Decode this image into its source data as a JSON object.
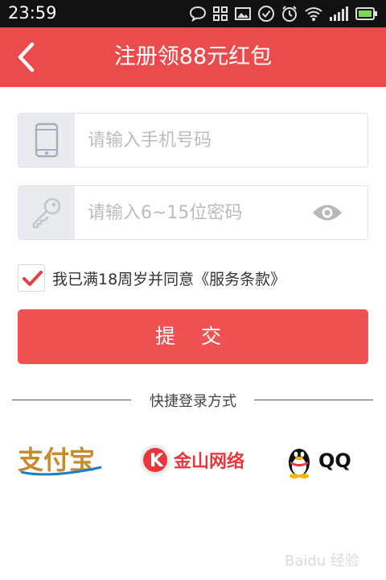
{
  "status_bar": {
    "time": "23:59",
    "icons": [
      "chat-icon",
      "apps-icon",
      "picture-icon",
      "check-icon",
      "alarm-icon",
      "wifi-icon",
      "signal-icon",
      "battery-icon"
    ],
    "battery_color": "#7ed957"
  },
  "header": {
    "title": "注册领88元红包",
    "background": "#ea4c4e"
  },
  "form": {
    "phone_placeholder": "请输入手机号码",
    "password_placeholder": "请输入6~15位密码",
    "agree_checked": true,
    "agree_text": "我已满18周岁并同意《服务条款》",
    "submit_label": "提 交",
    "accent_color": "#f05153"
  },
  "quick_login": {
    "label": "快捷登录方式",
    "providers": [
      {
        "name": "支付宝",
        "icon": "alipay-logo"
      },
      {
        "name": "金山网络",
        "icon": "kingsoft-logo"
      },
      {
        "name": "QQ",
        "icon": "qq-penguin-logo"
      }
    ]
  },
  "watermark": {
    "text": "Baidu 经验",
    "icon": "baidu-paw-icon"
  }
}
